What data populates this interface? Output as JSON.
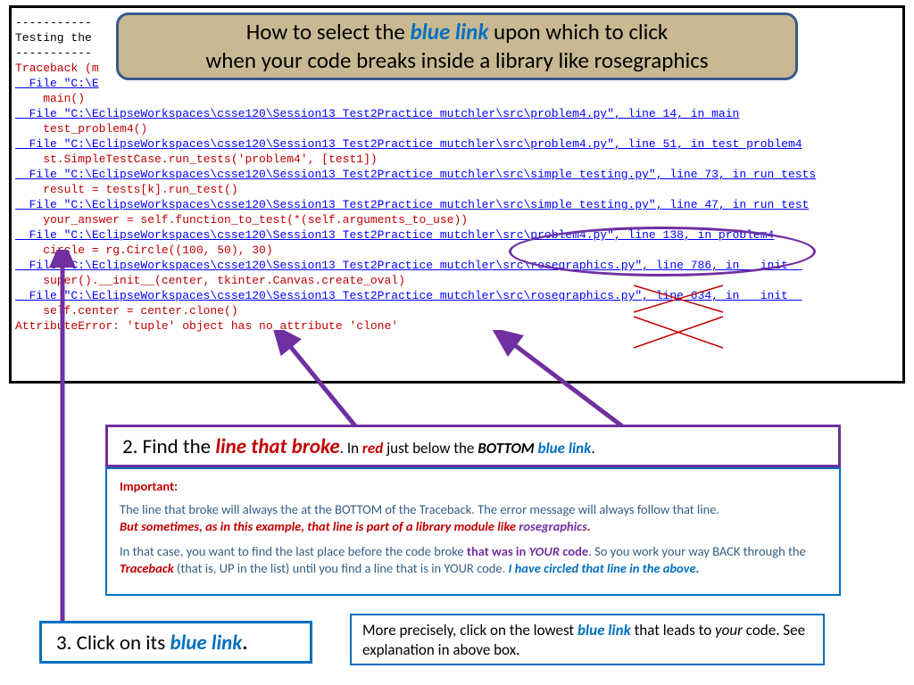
{
  "title": {
    "line1_pre": "How to select the ",
    "line1_blue": "blue link",
    "line1_post": " upon which to click",
    "line2": "when your code breaks inside a library like rosegraphics"
  },
  "console": {
    "dash": "-----------",
    "testing": "Testing the",
    "traceback": "Traceback (m",
    "file_trunc": "  File \"C:\\E",
    "main_call": "    main()",
    "file1": "  File \"C:\\EclipseWorkspaces\\csse120\\Session13 Test2Practice mutchler\\src\\problem4.py\", line 14, in main",
    "code1": "    test_problem4()",
    "file2": "  File \"C:\\EclipseWorkspaces\\csse120\\Session13 Test2Practice mutchler\\src\\problem4.py\", line 51, in test_problem4",
    "code2": "    st.SimpleTestCase.run_tests('problem4', [test1])",
    "file3": "  File \"C:\\EclipseWorkspaces\\csse120\\Session13 Test2Practice mutchler\\src\\simple_testing.py\", line 73, in run_tests",
    "code3": "    result = tests[k].run_test()",
    "file4": "  File \"C:\\EclipseWorkspaces\\csse120\\Session13 Test2Practice mutchler\\src\\simple_testing.py\", line 47, in run_test",
    "code4": "    your_answer = self.function_to_test(*(self.arguments_to_use))",
    "file5": "  File \"C:\\EclipseWorkspaces\\csse120\\Session13 Test2Practice mutchler\\src\\problem4.py\", line 138, in problem4",
    "code5": "    circle = rg.Circle((100, 50), 30)",
    "file6": "  File \"C:\\EclipseWorkspaces\\csse120\\Session13 Test2Practice mutchler\\src\\rosegraphics.py\", line 786, in   init  ",
    "code6": "    super().__init__(center, tkinter.Canvas.create_oval)",
    "file7": "  File \"C:\\EclipseWorkspaces\\csse120\\Session13 Test2Practice mutchler\\src\\rosegraphics.py\", line 634, in   init  ",
    "code7": "    self.center = center.clone()",
    "error": "AttributeError: 'tuple' object has no attribute 'clone'"
  },
  "step2": {
    "num": "2.  Find the ",
    "emph": "line that broke",
    "mid1": ".  In ",
    "red": "red",
    "mid2": " just below the ",
    "bottom": "BOTTOM",
    "sp": " ",
    "blue": "blue link",
    "dot": "."
  },
  "important": {
    "hdr": "Important:",
    "p1": "The line that broke will always the at the BOTTOM of the Traceback.  The error message will always follow that line.",
    "p2a": "But sometimes, as in this example, that line is part of a library module like ",
    "p2b": "rosegraphics",
    "p2c": ".",
    "p3a": "In that case, you want to find the last place before the code broke ",
    "p3b": "that was in ",
    "p3c": "YOUR",
    "p3d": " code",
    "p3e": ".  So you work your way BACK through the ",
    "p3f": "Traceback",
    "p3g": " (that is, UP in the list) until you find a line that is in YOUR code.  ",
    "p3h": "I have circled that line in the above."
  },
  "step3": {
    "num": "3.  Click on its ",
    "blue": "blue link",
    "dot": "."
  },
  "precise": {
    "a": "More precisely, click on the lowest ",
    "b": "blue link",
    "c": " that leads to ",
    "d": "your",
    "e": " code.  See explanation in above box."
  }
}
